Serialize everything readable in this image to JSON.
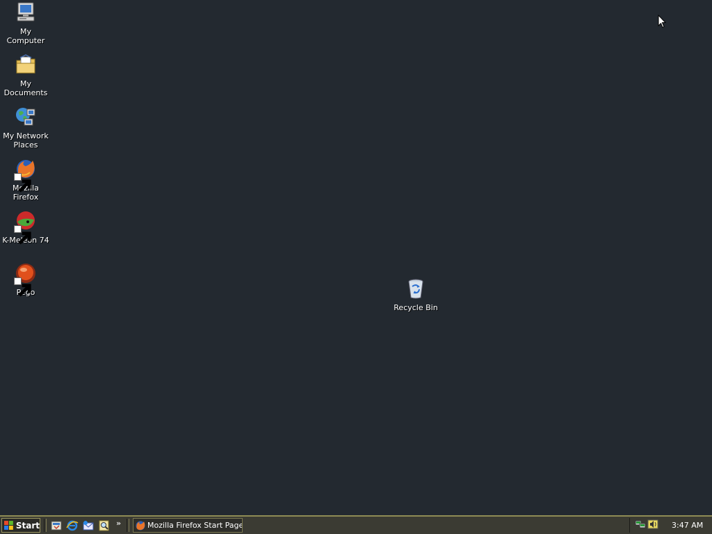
{
  "desktop": {
    "icons": [
      {
        "label": "My Computer",
        "icon": "my-computer-icon"
      },
      {
        "label": "My Documents",
        "icon": "my-documents-icon"
      },
      {
        "label": "My Network Places",
        "icon": "my-network-places-icon"
      },
      {
        "label": "Mozilla Firefox",
        "icon": "firefox-icon",
        "shortcut": true
      },
      {
        "label": "K-Meleon 74",
        "icon": "k-meleon-icon",
        "shortcut": true
      },
      {
        "label": "Pego",
        "icon": "pego-icon",
        "shortcut": true
      },
      {
        "label": "Recycle Bin",
        "icon": "recycle-bin-icon"
      }
    ],
    "background_color": "#232930"
  },
  "taskbar": {
    "start_label": "Start",
    "quick_launch": [
      {
        "icon": "show-desktop-icon"
      },
      {
        "icon": "internet-explorer-icon"
      },
      {
        "icon": "outlook-express-icon"
      },
      {
        "icon": "search-icon"
      }
    ],
    "more_label": "»",
    "tasks": [
      {
        "label": "Mozilla Firefox Start Page...",
        "icon": "firefox-icon"
      }
    ],
    "tray": {
      "icons": [
        {
          "icon": "network-icon"
        },
        {
          "icon": "volume-icon"
        }
      ],
      "clock": "3:47 AM"
    },
    "color": "#3b3b33",
    "accent": "#8f8c55"
  }
}
